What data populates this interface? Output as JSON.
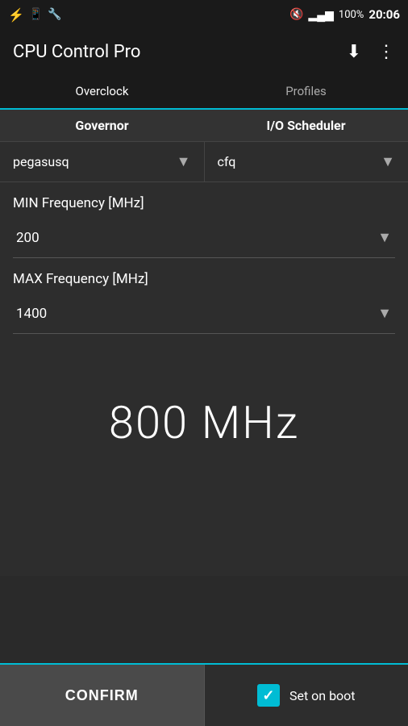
{
  "statusBar": {
    "usbIcon": "⚡",
    "androidIcon": "🤖",
    "toolsIcon": "🔧",
    "muteIcon": "🔇",
    "signalIcon": "📶",
    "batteryPercent": "100%",
    "time": "20:06"
  },
  "titleBar": {
    "title": "CPU Control Pro",
    "downloadIcon": "⬇",
    "menuIcon": "⋮"
  },
  "tabs": [
    {
      "label": "Overclock",
      "active": true
    },
    {
      "label": "Profiles",
      "active": false
    }
  ],
  "controls": {
    "governorHeader": "Governor",
    "ioHeader": "I/O Scheduler",
    "governorValue": "pegasusq",
    "ioValue": "cfq",
    "minFreqLabel": "MIN Frequency [MHz]",
    "minFreqValue": "200",
    "maxFreqLabel": "MAX Frequency [MHz]",
    "maxFreqValue": "1400",
    "currentMhz": "800 MHz"
  },
  "bottomBar": {
    "confirmLabel": "CONFIRM",
    "setOnBootLabel": "Set on boot",
    "setOnBootChecked": true
  }
}
